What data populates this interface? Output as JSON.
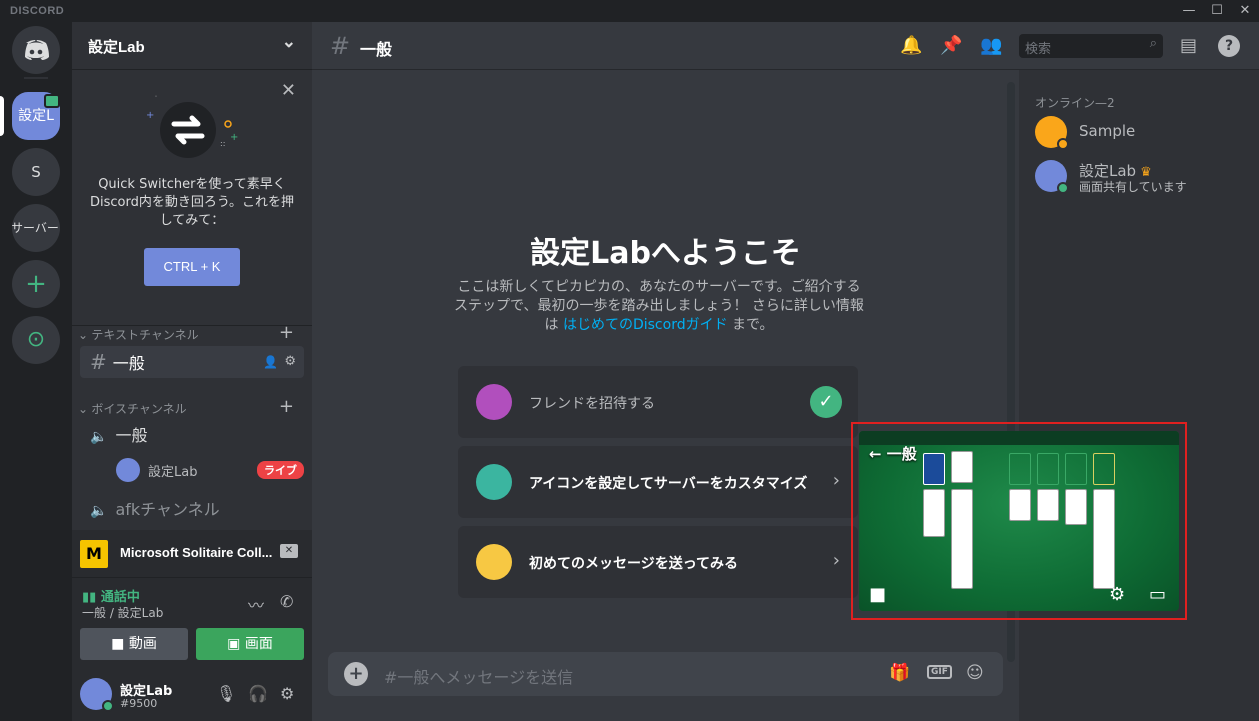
{
  "titlebar": {
    "brand": "DISCORD",
    "minimize": "—",
    "maximize": "☐",
    "close": "✕"
  },
  "servers": [
    {
      "label": "設定L",
      "active": true
    },
    {
      "label": "S"
    },
    {
      "label": "のサーバー"
    },
    {
      "label": "+"
    },
    {
      "label": "⊙"
    }
  ],
  "guild": {
    "name": "設定Lab"
  },
  "quick_switcher": {
    "text": "Quick Switcherを使って素早くDiscord内を動き回ろう。これを押してみて：",
    "button": "CTRL + K"
  },
  "categories": {
    "text": "テキストチャンネル",
    "voice": "ボイスチャンネル"
  },
  "text_channels": [
    {
      "name": "一般"
    }
  ],
  "voice_channels": [
    {
      "name": "一般"
    },
    {
      "name": "afkチャンネル"
    }
  ],
  "voice_user": {
    "name": "設定Lab",
    "badge": "ライブ"
  },
  "activity": {
    "title": "Microsoft Solitaire Coll...",
    "icon_letter": "M"
  },
  "voice_panel": {
    "status": "通話中",
    "location": "一般 / 設定Lab",
    "video_button": "動画",
    "screen_button": "画面"
  },
  "user": {
    "name": "設定Lab",
    "tag": "#9500"
  },
  "header": {
    "channel": "一般",
    "search_placeholder": "検索"
  },
  "welcome": {
    "title": "設定Labへようこそ",
    "desc_pre": "ここは新しくてピカピカの、あなたのサーバーです。ご紹介するステップで、最初の一歩を踏み出しましょう！ さらに詳しい情報は ",
    "desc_link": "はじめてのDiscordガイド",
    "desc_post": " まで。"
  },
  "cards": [
    {
      "label": "フレンドを招待する",
      "done": true,
      "color": "#b14fbd"
    },
    {
      "label": "アイコンを設定してサーバーをカスタマイズ",
      "done": false,
      "color": "#3bb5a0"
    },
    {
      "label": "初めてのメッセージを送ってみる",
      "done": false,
      "color": "#f7c843"
    }
  ],
  "message_box": {
    "placeholder": "#一般へメッセージを送信",
    "gif": "GIF"
  },
  "members": {
    "category": "オンライン—2",
    "list": [
      {
        "name": "Sample",
        "sub": "",
        "avatar_color": "#faa61a",
        "status_color": "#faa61a"
      },
      {
        "name": "設定Lab",
        "sub": "画面共有しています",
        "avatar_color": "#7289da",
        "status_color": "#43b581"
      }
    ]
  },
  "stream": {
    "label": "← 一般"
  },
  "colors": {
    "accent": "#7289da",
    "green": "#43b581",
    "live": "#ed4245",
    "frame": "#e02020"
  }
}
